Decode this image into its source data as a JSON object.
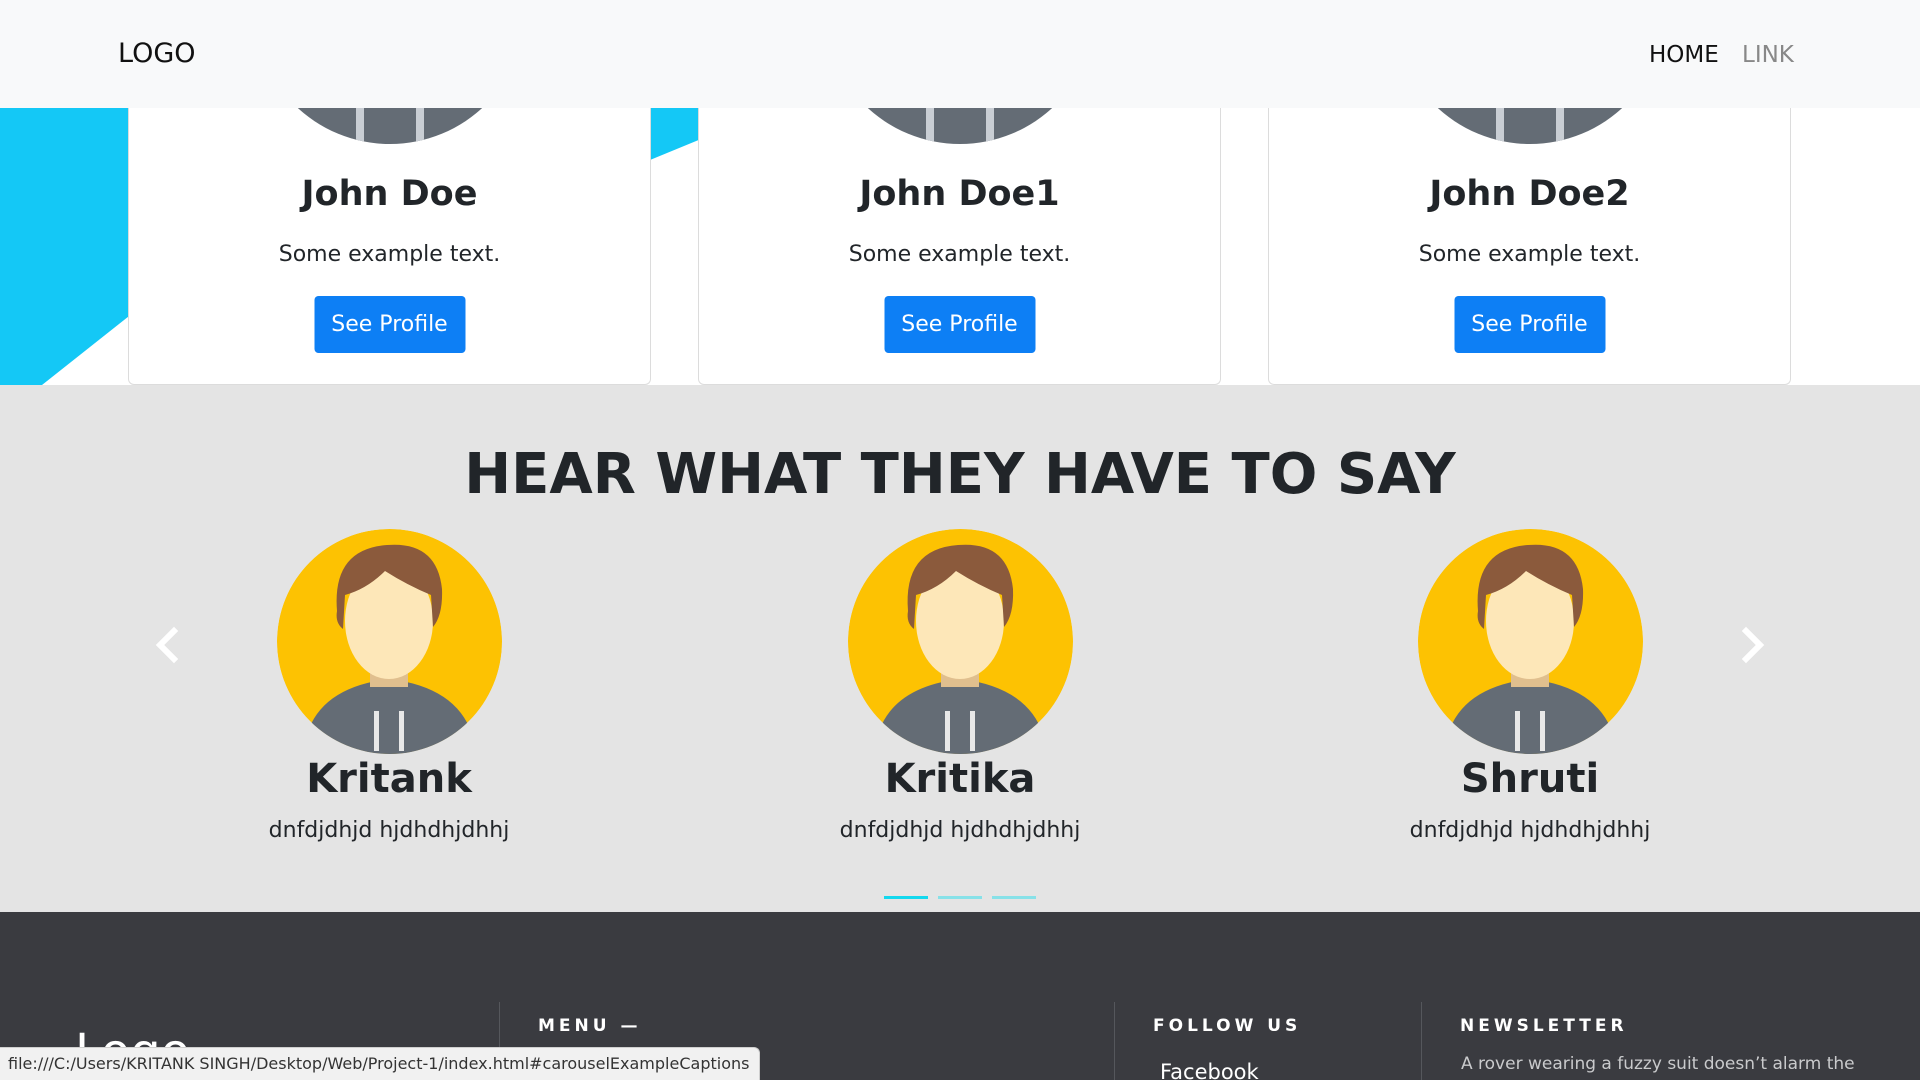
{
  "navbar": {
    "logo": "LOGO",
    "links": [
      "HOME",
      "LINK"
    ]
  },
  "team": {
    "cards": [
      {
        "name": "John Doe",
        "text": "Some example text.",
        "button": "See Profile"
      },
      {
        "name": "John Doe1",
        "text": "Some example text.",
        "button": "See Profile"
      },
      {
        "name": "John Doe2",
        "text": "Some example text.",
        "button": "See Profile"
      }
    ]
  },
  "testimonials": {
    "heading": "HEAR WHAT THEY HAVE TO SAY",
    "items": [
      {
        "name": "Kritank",
        "text": "dnfdjdhjd hjdhdhjdhhj"
      },
      {
        "name": "Kritika",
        "text": "dnfdjdhjd hjdhdhjdhhj"
      },
      {
        "name": "Shruti",
        "text": "dnfdjdhjd hjdhdhjdhhj"
      }
    ],
    "indicator_count": 3,
    "active_indicator": 0
  },
  "footer": {
    "logo": "Logo",
    "menu_title": "MENU —",
    "follow_title": "FOLLOW US",
    "follow_link": "Facebook",
    "newsletter_title": "NEWSLETTER",
    "newsletter_text": "A rover wearing a fuzzy suit doesn’t alarm the"
  },
  "status_url": "file:///C:/Users/KRITANK SINGH/Desktop/Web/Project-1/index.html#carouselExampleCaptions",
  "colors": {
    "accent_blue": "#14c8f6",
    "button_blue": "#0d7ff5",
    "indicator": "#14d8ee",
    "avatar_bg": "#fdc202"
  }
}
